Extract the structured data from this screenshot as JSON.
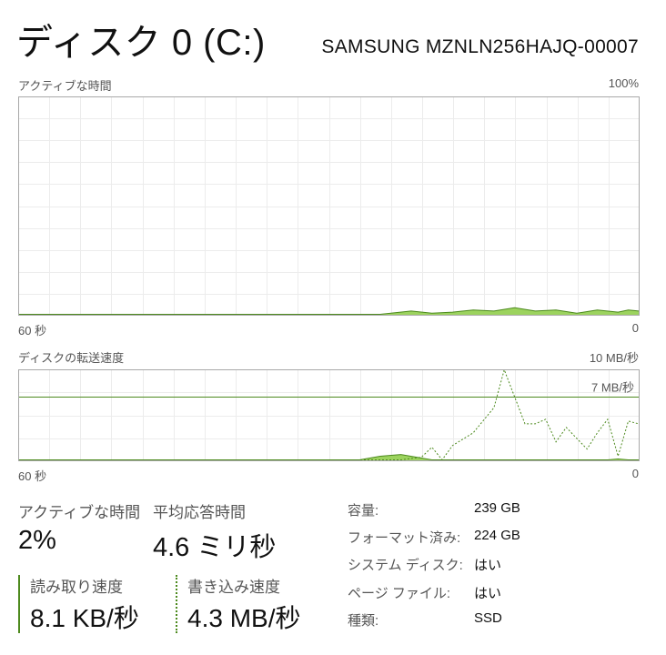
{
  "header": {
    "title": "ディスク 0 (C:)",
    "model": "SAMSUNG MZNLN256HAJQ-00007"
  },
  "activity_chart": {
    "label": "アクティブな時間",
    "max_label": "100%",
    "x_left_label": "60 秒",
    "x_right_label": "0",
    "line_color": "#4d8a1e",
    "fill_color": "#9cd35e"
  },
  "transfer_chart": {
    "label": "ディスクの転送速度",
    "max_label": "10 MB/秒",
    "ref_label": "7 MB/秒",
    "x_left_label": "60 秒",
    "x_right_label": "0",
    "line_color": "#4d8a1e",
    "fill_color": "#9cd35e"
  },
  "stats": {
    "active_time_label": "アクティブな時間",
    "active_time_value": "2%",
    "avg_response_label": "平均応答時間",
    "avg_response_value": "4.6 ミリ秒",
    "read_speed_label": "読み取り速度",
    "read_speed_value": "8.1 KB/秒",
    "write_speed_label": "書き込み速度",
    "write_speed_value": "4.3 MB/秒"
  },
  "properties": [
    {
      "label": "容量:",
      "value": "239 GB"
    },
    {
      "label": "フォーマット済み:",
      "value": "224 GB"
    },
    {
      "label": "システム ディスク:",
      "value": "はい"
    },
    {
      "label": "ページ ファイル:",
      "value": "はい"
    },
    {
      "label": "種類:",
      "value": "SSD"
    }
  ],
  "chart_data": [
    {
      "type": "area",
      "title": "アクティブな時間",
      "ylabel": "",
      "xlabel": "",
      "ylim": [
        0,
        100
      ],
      "xlim": [
        60,
        0
      ],
      "x": [
        60,
        45,
        38,
        30,
        25,
        22,
        20,
        18,
        16,
        14,
        12,
        10,
        8,
        6,
        4,
        2,
        1,
        0
      ],
      "series": [
        {
          "values": [
            0,
            0,
            0,
            0,
            0,
            1.5,
            0.5,
            1,
            2,
            1.5,
            3,
            1.5,
            2,
            0.5,
            2,
            1,
            2,
            1.5
          ]
        }
      ],
      "grid": true
    },
    {
      "type": "line",
      "title": "ディスクの転送速度",
      "ylabel": "",
      "xlabel": "",
      "ylim": [
        0,
        10
      ],
      "xlim": [
        60,
        0
      ],
      "reference_line": 7,
      "x": [
        60,
        45,
        35,
        31,
        29,
        27,
        25,
        23,
        21,
        20,
        19,
        18,
        16,
        14,
        13,
        12,
        11,
        10,
        9,
        8,
        7,
        5,
        4,
        3,
        2,
        1,
        0
      ],
      "series": [
        {
          "name": "読み取り速度",
          "values": [
            0,
            0,
            0,
            0,
            0,
            0,
            0.4,
            0.6,
            0.2,
            0,
            0,
            0,
            0,
            0,
            0,
            0,
            0,
            0,
            0,
            0,
            0,
            0,
            0,
            0,
            0.1,
            0,
            0
          ]
        },
        {
          "name": "書き込み速度",
          "values": [
            0,
            0,
            0,
            0,
            0,
            0,
            0,
            0,
            0.3,
            1.4,
            0,
            1.6,
            3.0,
            5.8,
            10.0,
            7.0,
            4.0,
            4.0,
            4.5,
            2.0,
            3.6,
            1.2,
            3.0,
            4.5,
            0.4,
            4.3,
            4.0
          ]
        }
      ],
      "grid": true
    }
  ]
}
